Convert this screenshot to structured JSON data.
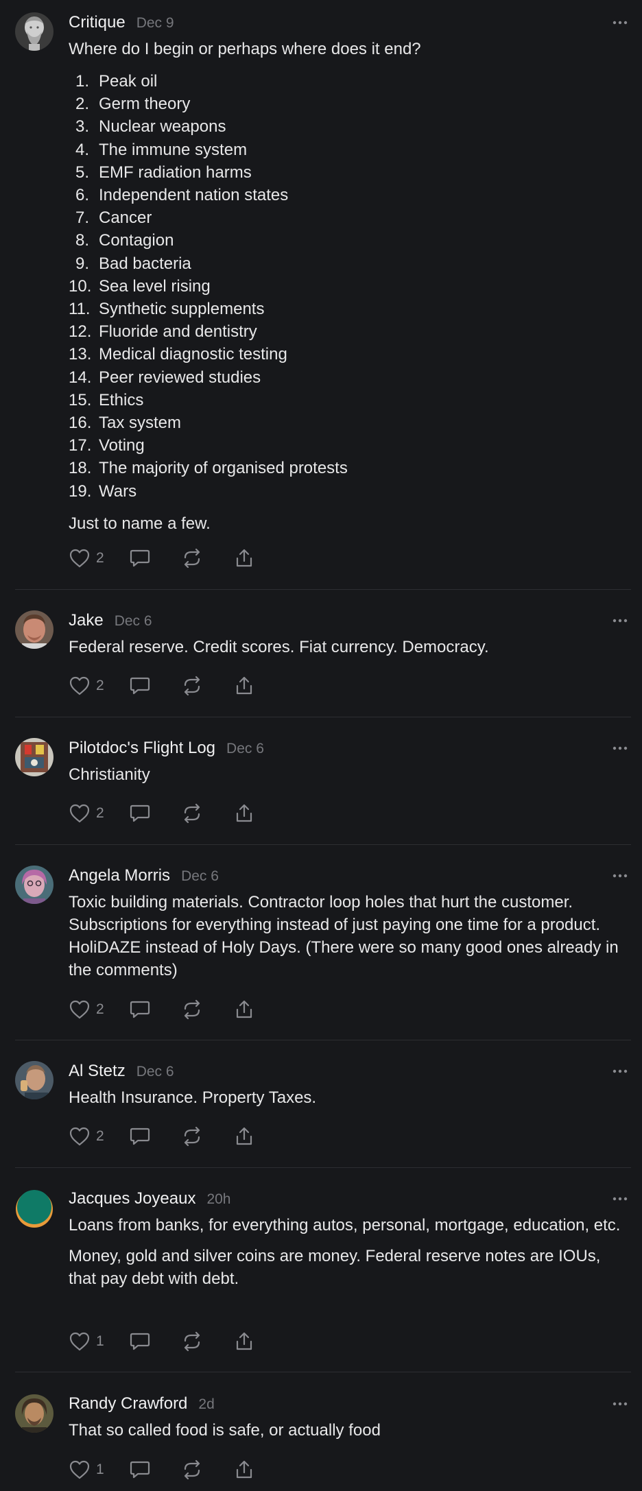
{
  "comments": [
    {
      "author": "Critique",
      "date": "Dec 9",
      "avatar_icon": "statue-bust-avatar",
      "paragraphs_before": [
        "Where do I begin or perhaps where does it end?"
      ],
      "list": [
        {
          "n": "1.",
          "t": "Peak oil"
        },
        {
          "n": "2.",
          "t": "Germ theory"
        },
        {
          "n": "3.",
          "t": "Nuclear weapons"
        },
        {
          "n": "4.",
          "t": "The immune system"
        },
        {
          "n": "5.",
          "t": "EMF radiation harms"
        },
        {
          "n": "6.",
          "t": "Independent nation states"
        },
        {
          "n": "7.",
          "t": "Cancer"
        },
        {
          "n": "8.",
          "t": "Contagion"
        },
        {
          "n": "9.",
          "t": "Bad bacteria"
        },
        {
          "n": "10.",
          "t": "Sea level rising"
        },
        {
          "n": "11.",
          "t": "Synthetic supplements"
        },
        {
          "n": "12.",
          "t": "Fluoride and dentistry"
        },
        {
          "n": "13.",
          "t": "Medical diagnostic testing"
        },
        {
          "n": "14.",
          "t": "Peer reviewed studies"
        },
        {
          "n": "15.",
          "t": "Ethics"
        },
        {
          "n": "16.",
          "t": "Tax system"
        },
        {
          "n": "17.",
          "t": "Voting"
        },
        {
          "n": "18.",
          "t": "The majority of organised protests"
        },
        {
          "n": "19.",
          "t": "Wars"
        }
      ],
      "paragraphs_after": [
        "Just to name a few."
      ],
      "likes": "2"
    },
    {
      "author": "Jake",
      "date": "Dec 6",
      "avatar_icon": "person-photo-avatar",
      "paragraphs_before": [
        "Federal reserve. Credit scores. Fiat currency. Democracy."
      ],
      "likes": "2"
    },
    {
      "author": "Pilotdoc's Flight Log",
      "date": "Dec 6",
      "avatar_icon": "flight-log-avatar",
      "paragraphs_before": [
        "Christianity"
      ],
      "likes": "2"
    },
    {
      "author": "Angela Morris",
      "date": "Dec 6",
      "avatar_icon": "person-photo-avatar",
      "paragraphs_before": [
        "Toxic building materials. Contractor loop holes that hurt the customer. Subscriptions for everything instead of just paying one time for a product. HoliDAZE instead of Holy Days. (There were so many good ones already in the comments)"
      ],
      "likes": "2"
    },
    {
      "author": "Al Stetz",
      "date": "Dec 6",
      "avatar_icon": "person-photo-avatar",
      "paragraphs_before": [
        "Health Insurance. Property Taxes."
      ],
      "likes": "2"
    },
    {
      "author": "Jacques Joyeaux",
      "date": "20h",
      "avatar_icon": "teal-circle-avatar",
      "paragraphs_before": [
        "Loans from banks, for everything autos, personal, mortgage, education, etc.",
        "Money, gold and silver coins are money. Federal reserve notes are IOUs, that pay debt with debt."
      ],
      "likes": "1"
    },
    {
      "author": "Randy Crawford",
      "date": "2d",
      "avatar_icon": "person-photo-avatar",
      "paragraphs_before": [
        "That so called food is safe, or actually food"
      ],
      "likes": "1"
    }
  ],
  "icons": {
    "more": "more-horizontal-icon",
    "like": "heart-icon",
    "reply": "comment-bubble-icon",
    "restack": "restack-icon",
    "share": "share-icon"
  },
  "colors": {
    "background": "#17181b",
    "text": "#e8e8e9",
    "muted": "#76777c",
    "divider": "#2d2e32",
    "icon": "#8a8b90"
  }
}
